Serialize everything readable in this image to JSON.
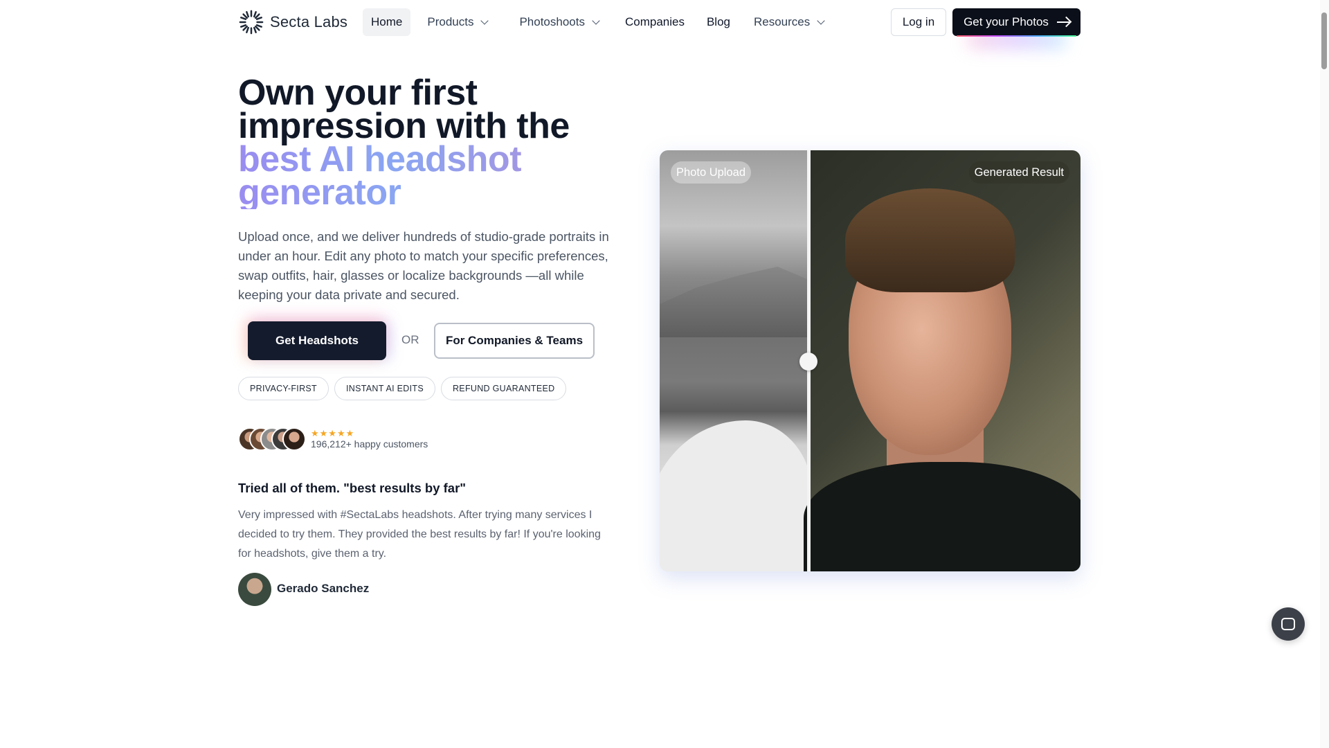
{
  "brand": {
    "name": "Secta Labs"
  },
  "nav": {
    "items": [
      {
        "label": "Home",
        "active": true,
        "dropdown": false
      },
      {
        "label": "Products",
        "active": false,
        "dropdown": true
      },
      {
        "label": "Photoshoots",
        "active": false,
        "dropdown": true
      },
      {
        "label": "Companies",
        "active": false,
        "dropdown": false
      },
      {
        "label": "Blog",
        "active": false,
        "dropdown": false
      },
      {
        "label": "Resources",
        "active": false,
        "dropdown": true
      }
    ],
    "login_label": "Log in",
    "cta_label": "Get your Photos"
  },
  "hero": {
    "title_line1": "Own your first",
    "title_line2": "impression with the",
    "title_highlight1": "best AI headshot",
    "title_highlight2": "generator",
    "description": "Upload once, and we deliver hundreds of studio-grade portraits in under an hour. Edit any photo to match your specific preferences, swap outfits, hair, glasses or localize backgrounds —all while keeping your data private and secured.",
    "primary_label": "Get Headshots",
    "or_label": "OR",
    "secondary_label": "For Companies & Teams",
    "pills": [
      "PRIVACY-FIRST",
      "INSTANT AI EDITS",
      "REFUND GUARANTEED"
    ],
    "rating_stars": "★★★★★",
    "customers_text": "196,212+ happy customers"
  },
  "testimonial": {
    "title": "Tried all of them. \"best results by far\"",
    "body": "Very impressed with #SectaLabs headshots. After trying many services I decided to try them. They provided the best results by far! If you're looking for headshots, give them a try.",
    "author": "Gerado Sanchez"
  },
  "comparison": {
    "left_label": "Photo Upload",
    "right_label": "Generated Result"
  },
  "colors": {
    "primary": "#141b2d",
    "nav_cta": "#0b0f19",
    "accent_gradient_start": "#9a8cf0",
    "accent_gradient_end": "#b48ad8",
    "star": "#f5a623"
  }
}
